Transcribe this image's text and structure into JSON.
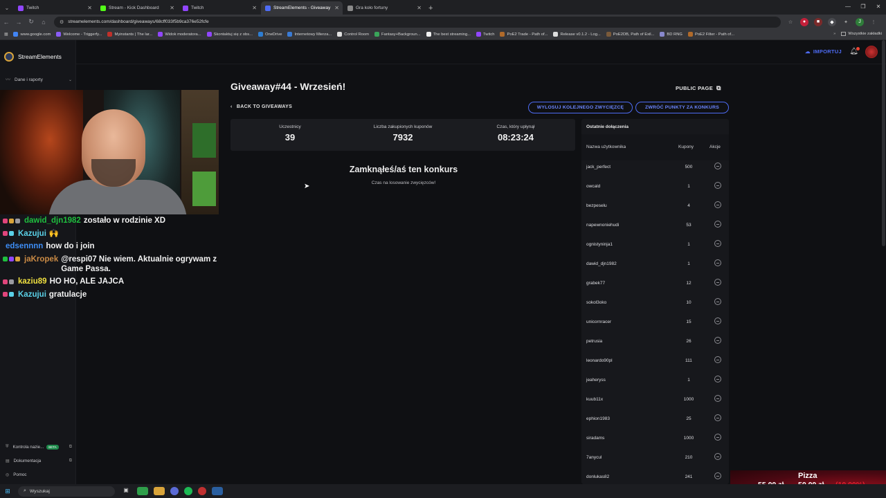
{
  "browser": {
    "tabs": [
      {
        "label": "Twitch",
        "color": "#9146ff"
      },
      {
        "label": "Stream - Kick Dashboard",
        "color": "#53fc18"
      },
      {
        "label": "Twitch",
        "color": "#9146ff"
      },
      {
        "label": "StreamElements - Giveaway",
        "color": "#4e6cf5",
        "active": true
      },
      {
        "label": "Gra koło fortuny",
        "color": "#8a8a8a"
      }
    ],
    "url": "streamelements.com/dashboard/giveaways/68cff033f5b9ca376e52fcfe",
    "bookmarks": [
      "www.google.com",
      "Welcome - Triggerfy...",
      "Myinstants | The lar...",
      "Widok moderatora...",
      "Skontaktuj się z obs...",
      "OneDrive",
      "Internetowy Mierza...",
      "Control Room",
      "Fantasy+Backgroun...",
      "The best streaming...",
      "Twitch",
      "PoE2 Trade - Path of...",
      "Release v0.1.2 - Log...",
      "PoE2DB, Path of Exil...",
      "BD RNG",
      "PoE2 Filter - Path of..."
    ],
    "bookmarks_all": "Wszystkie zakładki"
  },
  "sidebar": {
    "brand": "StreamElements",
    "dane": "Dane i raporty",
    "footer": [
      {
        "label": "Kontrola nazie...",
        "badge": "BETA"
      },
      {
        "label": "Dokumentacja"
      },
      {
        "label": "Pomoc"
      }
    ]
  },
  "chat": [
    {
      "user": "dawid_djn1982",
      "color": "#1fbf3f",
      "text": "zostało w rodzinie XD"
    },
    {
      "user": "Kazujui",
      "color": "#5ad1e8",
      "text": "🙌"
    },
    {
      "user": "edsennnn",
      "color": "#3d8df5",
      "text": "how do i join"
    },
    {
      "user": "jaKropek",
      "color": "#c98a45",
      "text": "@respi07 Nie wiem. Aktualnie ogrywam z Game Passa."
    },
    {
      "user": "kaziu89",
      "color": "#f0e040",
      "text": "HO HO, ALE JAJCA"
    },
    {
      "user": "Kazujui",
      "color": "#5ad1e8",
      "text": "gratulacje"
    }
  ],
  "header": {
    "importuj": "IMPORTUJ"
  },
  "giveaway": {
    "title": "Giveaway#44 - Wrzesień!",
    "public_page": "PUBLIC PAGE",
    "back": "BACK TO GIVEAWAYS",
    "btn_draw": "WYLOSUJ KOLEJNEGO ZWYCIĘZCĘ",
    "btn_refund": "ZWRÓĆ PUNKTY ZA KONKURS",
    "stats": [
      {
        "label": "Uczestnicy",
        "value": "39"
      },
      {
        "label": "Liczba zakupionych kuponów",
        "value": "7932"
      },
      {
        "label": "Czas, który upłynął",
        "value": "08:23:24"
      }
    ],
    "closed_title": "Zamknąłeś/aś ten konkurs",
    "closed_sub": "Czas na losowanie zwycięzców!"
  },
  "panel": {
    "title": "Ostatnie dołączenia",
    "col_user": "Nazwa użytkownika",
    "col_coupons": "Kupony",
    "col_actions": "Akcje",
    "rows": [
      {
        "user": "jack_perfect",
        "coupons": "500"
      },
      {
        "user": "owcald",
        "coupons": "1"
      },
      {
        "user": "bezpeselu",
        "coupons": "4"
      },
      {
        "user": "napewnoniehudi",
        "coupons": "53"
      },
      {
        "user": "ognistyninja1",
        "coupons": "1"
      },
      {
        "user": "dawid_djn1982",
        "coupons": "1"
      },
      {
        "user": "grabek77",
        "coupons": "12"
      },
      {
        "user": "sokol3oko",
        "coupons": "10"
      },
      {
        "user": "unicornracer",
        "coupons": "15"
      },
      {
        "user": "petrusia",
        "coupons": "26"
      },
      {
        "user": "leonardo90pl",
        "coupons": "111"
      },
      {
        "user": "jeaheryss",
        "coupons": "1"
      },
      {
        "user": "kuub11x",
        "coupons": "1000"
      },
      {
        "user": "ephion1983",
        "coupons": "25"
      },
      {
        "user": "siradams",
        "coupons": "1000"
      },
      {
        "user": "7anycul",
        "coupons": "210"
      },
      {
        "user": "donlukas82",
        "coupons": "241"
      }
    ]
  },
  "overlay": {
    "title": "Pizza",
    "price1": "55,00 zł",
    "price2": "50,00 zł",
    "pct": "(10,00%)"
  },
  "taskbar": {
    "search": "Wyszukaj"
  }
}
